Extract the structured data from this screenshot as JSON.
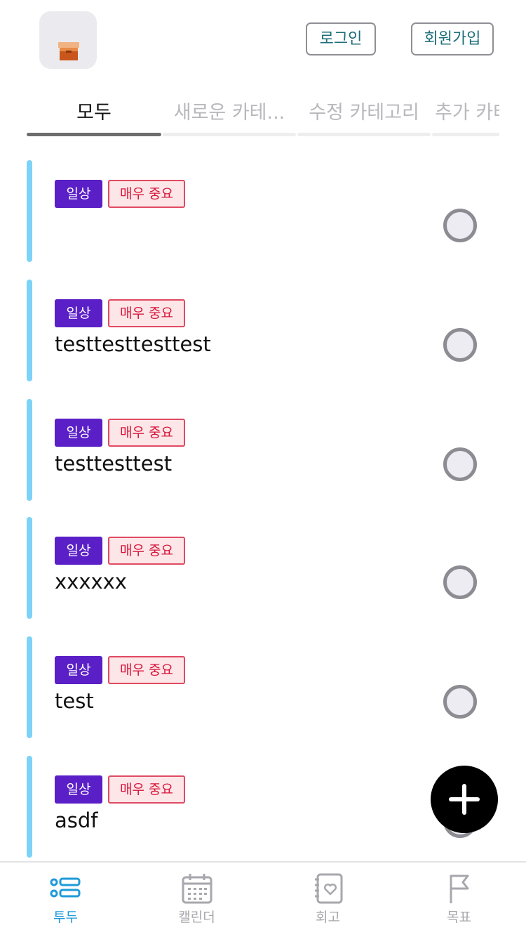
{
  "header": {
    "login_label": "로그인",
    "signup_label": "회원가입"
  },
  "tabs": [
    {
      "label": "모두",
      "active": true
    },
    {
      "label": "새로운 카테...",
      "active": false
    },
    {
      "label": "수정 카테고리",
      "active": false
    },
    {
      "label": "추가 카테",
      "active": false
    }
  ],
  "todos": [
    {
      "category": "일상",
      "priority": "매우 중요",
      "title": ""
    },
    {
      "category": "일상",
      "priority": "매우 중요",
      "title": "testtesttesttest"
    },
    {
      "category": "일상",
      "priority": "매우 중요",
      "title": "testtesttest"
    },
    {
      "category": "일상",
      "priority": "매우 중요",
      "title": "xxxxxx"
    },
    {
      "category": "일상",
      "priority": "매우 중요",
      "title": "test"
    },
    {
      "category": "일상",
      "priority": "매우 중요",
      "title": "asdf"
    }
  ],
  "bottom_nav": [
    {
      "label": "투두",
      "icon": "list-icon",
      "active": true
    },
    {
      "label": "캘린더",
      "icon": "calendar-icon",
      "active": false
    },
    {
      "label": "회고",
      "icon": "journal-heart-icon",
      "active": false
    },
    {
      "label": "목표",
      "icon": "flag-icon",
      "active": false
    }
  ],
  "colors": {
    "category_badge": "#5a1fc6",
    "priority_text": "#d7153a",
    "priority_bg": "#fde6e8",
    "accent_bar": "#7dd3f7",
    "nav_active": "#1f9ad9",
    "auth_text": "#1c6e79"
  }
}
